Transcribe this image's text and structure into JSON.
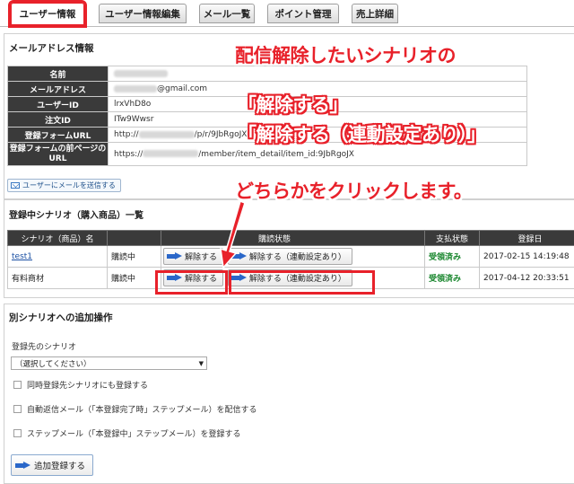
{
  "tabs": [
    {
      "label": "ユーザー情報"
    },
    {
      "label": "ユーザー情報編集"
    },
    {
      "label": "メール一覧"
    },
    {
      "label": "ポイント管理"
    },
    {
      "label": "売上詳細"
    }
  ],
  "mail_info": {
    "title": "メールアドレス情報",
    "rows": [
      {
        "key": "名前",
        "value": ""
      },
      {
        "key": "メールアドレス",
        "value": "@gmail.com"
      },
      {
        "key": "ユーザーID",
        "value": "lrxVhD8o"
      },
      {
        "key": "注文ID",
        "value": "ITw9Wwsr"
      },
      {
        "key": "登録フォームURL",
        "value": "http://",
        "value_tail": "/p/r/9JbRgoJX"
      },
      {
        "key": "登録フォームの前ページのURL",
        "value": "https://",
        "value_tail": "/member/item_detail/item_id:9JbRgoJX"
      }
    ],
    "send_mail_label": "ユーザーにメールを送信する"
  },
  "scenario": {
    "title": "登録中シナリオ（購入商品）一覧",
    "headers": [
      "シナリオ（商品）名",
      "購読状態",
      "支払状態",
      "登録日"
    ],
    "rows": [
      {
        "name": "test1",
        "status": "購読中",
        "cancel": "解除する",
        "cancel_linked": "解除する（連動設定あり）",
        "payment": "受領済み",
        "date": "2017-02-15 14:19:48"
      },
      {
        "name": "有料商材",
        "status": "購読中",
        "cancel": "解除する",
        "cancel_linked": "解除する（連動設定あり）",
        "payment": "受領済み",
        "date": "2017-04-12 20:33:51"
      }
    ]
  },
  "add_ops": {
    "title": "別シナリオへの追加操作",
    "target_label": "登録先のシナリオ",
    "select_value": "（選択してください）",
    "checkboxes": [
      "同時登録先シナリオにも登録する",
      "自動返信メール（「本登録完了時」ステップメール）を配信する",
      "ステップメール（「本登録中」ステップメール）を登録する"
    ],
    "add_button": "追加登録する"
  },
  "annotation": {
    "line1": "配信解除したいシナリオの",
    "line2": "「解除する」",
    "line3": "「解除する（連動設定あり）」",
    "line4": "どちらかをクリックします。"
  },
  "colors": {
    "accent_red": "#e8212a",
    "header_dark": "#3a3a3a",
    "paid_green": "#15842a",
    "link_blue": "#1a4fa3"
  }
}
